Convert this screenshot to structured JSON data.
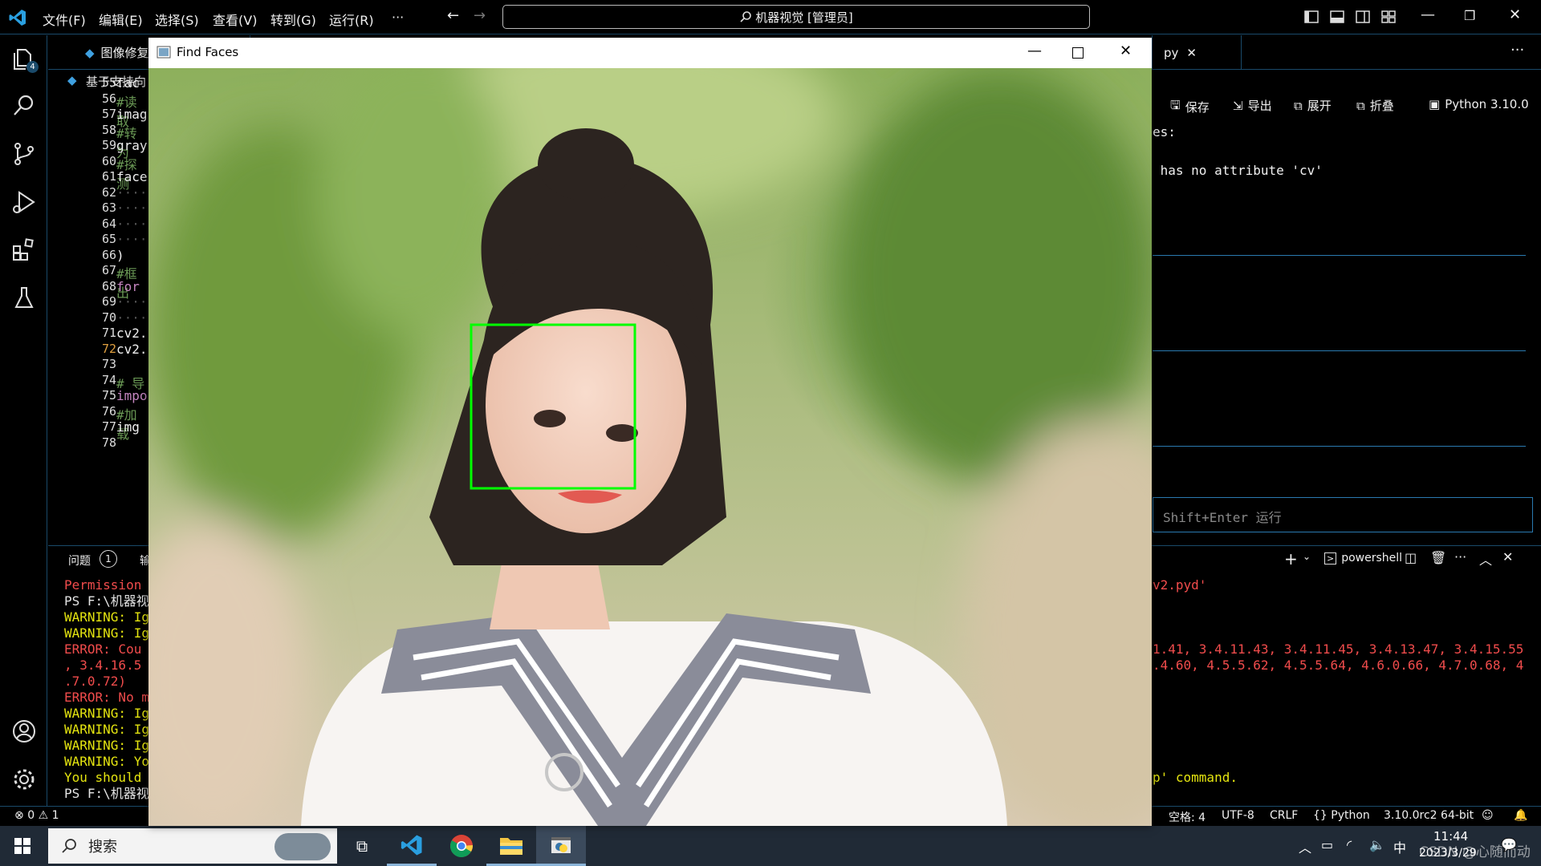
{
  "titlebar": {
    "menus": [
      "文件(F)",
      "编辑(E)",
      "选择(S)",
      "查看(V)",
      "转到(G)",
      "运行(R)",
      "···"
    ],
    "search_text": "机器视觉 [管理员]"
  },
  "activity": {
    "explorer_badge": "4"
  },
  "editor": {
    "tab_left": "图像修复",
    "tab_right": "py",
    "breadcrumb": "基于支持向",
    "line_numbers": [
      "55",
      "56",
      "57",
      "58",
      "59",
      "60",
      "61",
      "62",
      "63",
      "64",
      "65",
      "66",
      "67",
      "68",
      "69",
      "70",
      "71",
      "72",
      "73",
      "74",
      "75",
      "76",
      "77",
      "78"
    ],
    "code_lines": [
      "fac",
      "#读取",
      "imag",
      "#转为",
      "gray",
      "#探测",
      "face",
      "····",
      "····",
      "····",
      "····",
      ") ",
      "#框出",
      "for ",
      "····",
      "····",
      "cv2.",
      "cv2.",
      "",
      "# 导",
      "impo",
      "#加载",
      "img",
      ""
    ]
  },
  "notebook": {
    "save": "保存",
    "export": "导出",
    "expand": "展开",
    "collapse": "折叠",
    "kernel": "Python 3.10.0",
    "out1": "es:",
    "out2": " has no attribute 'cv'",
    "run_hint": "Shift+Enter 运行"
  },
  "panel": {
    "problems_label": "问题",
    "problems_count": "1",
    "output_label": "输",
    "shell": "powershell"
  },
  "terminal": {
    "left_lines": [
      {
        "text": "Permission",
        "cls": "red"
      },
      {
        "text": "PS F:\\机器视",
        "cls": "wht"
      },
      {
        "text": "WARNING: Ig",
        "cls": "yel"
      },
      {
        "text": "WARNING: Ig",
        "cls": "yel"
      },
      {
        "text": "ERROR: Cou",
        "cls": "red"
      },
      {
        "text": ", 3.4.16.5",
        "cls": "red"
      },
      {
        "text": ".7.0.72)",
        "cls": "red"
      },
      {
        "text": "ERROR: No m",
        "cls": "red"
      },
      {
        "text": "WARNING: Ig",
        "cls": "yel"
      },
      {
        "text": "WARNING: Ig",
        "cls": "yel"
      },
      {
        "text": "WARNING: Ig",
        "cls": "yel"
      },
      {
        "text": "WARNING: Yo",
        "cls": "yel"
      },
      {
        "text": "You should",
        "cls": "yel"
      },
      {
        "text": "PS F:\\机器视",
        "cls": "wht"
      }
    ],
    "right_pyd": "v2.pyd'",
    "right_ver1": "1.41, 3.4.11.43, 3.4.11.45, 3.4.13.47, 3.4.15.55",
    "right_ver2": ".4.60, 4.5.5.62, 4.5.5.64, 4.6.0.66, 4.7.0.68, 4",
    "right_cmd": "p' command."
  },
  "statusbar": {
    "errors": "0",
    "warnings": "1",
    "spaces": "空格: 4",
    "encoding": "UTF-8",
    "eol": "CRLF",
    "language": "Python",
    "interpreter": "3.10.0rc2 64-bit"
  },
  "taskbar": {
    "search": "搜索",
    "ime": "中",
    "time": "11:44",
    "date": "2023/3/29",
    "watermark": "CSDN @心随而动"
  },
  "findfaces": {
    "title": "Find Faces"
  },
  "colors": {
    "accent": "#2a7ab0",
    "face_box": "#00ff00",
    "error": "#f14c4c",
    "warning": "#e5e510"
  }
}
